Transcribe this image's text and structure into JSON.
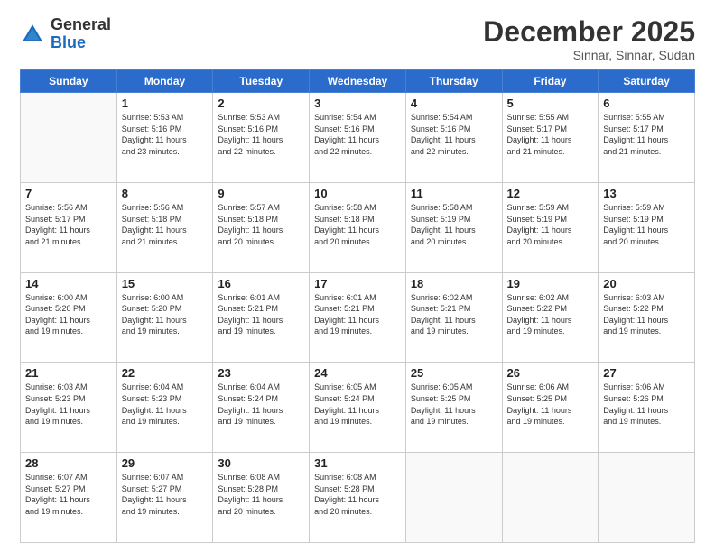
{
  "header": {
    "logo_general": "General",
    "logo_blue": "Blue",
    "month_title": "December 2025",
    "location": "Sinnar, Sinnar, Sudan"
  },
  "days_of_week": [
    "Sunday",
    "Monday",
    "Tuesday",
    "Wednesday",
    "Thursday",
    "Friday",
    "Saturday"
  ],
  "weeks": [
    [
      {
        "day": "",
        "info": ""
      },
      {
        "day": "1",
        "info": "Sunrise: 5:53 AM\nSunset: 5:16 PM\nDaylight: 11 hours\nand 23 minutes."
      },
      {
        "day": "2",
        "info": "Sunrise: 5:53 AM\nSunset: 5:16 PM\nDaylight: 11 hours\nand 22 minutes."
      },
      {
        "day": "3",
        "info": "Sunrise: 5:54 AM\nSunset: 5:16 PM\nDaylight: 11 hours\nand 22 minutes."
      },
      {
        "day": "4",
        "info": "Sunrise: 5:54 AM\nSunset: 5:16 PM\nDaylight: 11 hours\nand 22 minutes."
      },
      {
        "day": "5",
        "info": "Sunrise: 5:55 AM\nSunset: 5:17 PM\nDaylight: 11 hours\nand 21 minutes."
      },
      {
        "day": "6",
        "info": "Sunrise: 5:55 AM\nSunset: 5:17 PM\nDaylight: 11 hours\nand 21 minutes."
      }
    ],
    [
      {
        "day": "7",
        "info": "Sunrise: 5:56 AM\nSunset: 5:17 PM\nDaylight: 11 hours\nand 21 minutes."
      },
      {
        "day": "8",
        "info": "Sunrise: 5:56 AM\nSunset: 5:18 PM\nDaylight: 11 hours\nand 21 minutes."
      },
      {
        "day": "9",
        "info": "Sunrise: 5:57 AM\nSunset: 5:18 PM\nDaylight: 11 hours\nand 20 minutes."
      },
      {
        "day": "10",
        "info": "Sunrise: 5:58 AM\nSunset: 5:18 PM\nDaylight: 11 hours\nand 20 minutes."
      },
      {
        "day": "11",
        "info": "Sunrise: 5:58 AM\nSunset: 5:19 PM\nDaylight: 11 hours\nand 20 minutes."
      },
      {
        "day": "12",
        "info": "Sunrise: 5:59 AM\nSunset: 5:19 PM\nDaylight: 11 hours\nand 20 minutes."
      },
      {
        "day": "13",
        "info": "Sunrise: 5:59 AM\nSunset: 5:19 PM\nDaylight: 11 hours\nand 20 minutes."
      }
    ],
    [
      {
        "day": "14",
        "info": "Sunrise: 6:00 AM\nSunset: 5:20 PM\nDaylight: 11 hours\nand 19 minutes."
      },
      {
        "day": "15",
        "info": "Sunrise: 6:00 AM\nSunset: 5:20 PM\nDaylight: 11 hours\nand 19 minutes."
      },
      {
        "day": "16",
        "info": "Sunrise: 6:01 AM\nSunset: 5:21 PM\nDaylight: 11 hours\nand 19 minutes."
      },
      {
        "day": "17",
        "info": "Sunrise: 6:01 AM\nSunset: 5:21 PM\nDaylight: 11 hours\nand 19 minutes."
      },
      {
        "day": "18",
        "info": "Sunrise: 6:02 AM\nSunset: 5:21 PM\nDaylight: 11 hours\nand 19 minutes."
      },
      {
        "day": "19",
        "info": "Sunrise: 6:02 AM\nSunset: 5:22 PM\nDaylight: 11 hours\nand 19 minutes."
      },
      {
        "day": "20",
        "info": "Sunrise: 6:03 AM\nSunset: 5:22 PM\nDaylight: 11 hours\nand 19 minutes."
      }
    ],
    [
      {
        "day": "21",
        "info": "Sunrise: 6:03 AM\nSunset: 5:23 PM\nDaylight: 11 hours\nand 19 minutes."
      },
      {
        "day": "22",
        "info": "Sunrise: 6:04 AM\nSunset: 5:23 PM\nDaylight: 11 hours\nand 19 minutes."
      },
      {
        "day": "23",
        "info": "Sunrise: 6:04 AM\nSunset: 5:24 PM\nDaylight: 11 hours\nand 19 minutes."
      },
      {
        "day": "24",
        "info": "Sunrise: 6:05 AM\nSunset: 5:24 PM\nDaylight: 11 hours\nand 19 minutes."
      },
      {
        "day": "25",
        "info": "Sunrise: 6:05 AM\nSunset: 5:25 PM\nDaylight: 11 hours\nand 19 minutes."
      },
      {
        "day": "26",
        "info": "Sunrise: 6:06 AM\nSunset: 5:25 PM\nDaylight: 11 hours\nand 19 minutes."
      },
      {
        "day": "27",
        "info": "Sunrise: 6:06 AM\nSunset: 5:26 PM\nDaylight: 11 hours\nand 19 minutes."
      }
    ],
    [
      {
        "day": "28",
        "info": "Sunrise: 6:07 AM\nSunset: 5:27 PM\nDaylight: 11 hours\nand 19 minutes."
      },
      {
        "day": "29",
        "info": "Sunrise: 6:07 AM\nSunset: 5:27 PM\nDaylight: 11 hours\nand 19 minutes."
      },
      {
        "day": "30",
        "info": "Sunrise: 6:08 AM\nSunset: 5:28 PM\nDaylight: 11 hours\nand 20 minutes."
      },
      {
        "day": "31",
        "info": "Sunrise: 6:08 AM\nSunset: 5:28 PM\nDaylight: 11 hours\nand 20 minutes."
      },
      {
        "day": "",
        "info": ""
      },
      {
        "day": "",
        "info": ""
      },
      {
        "day": "",
        "info": ""
      }
    ]
  ]
}
